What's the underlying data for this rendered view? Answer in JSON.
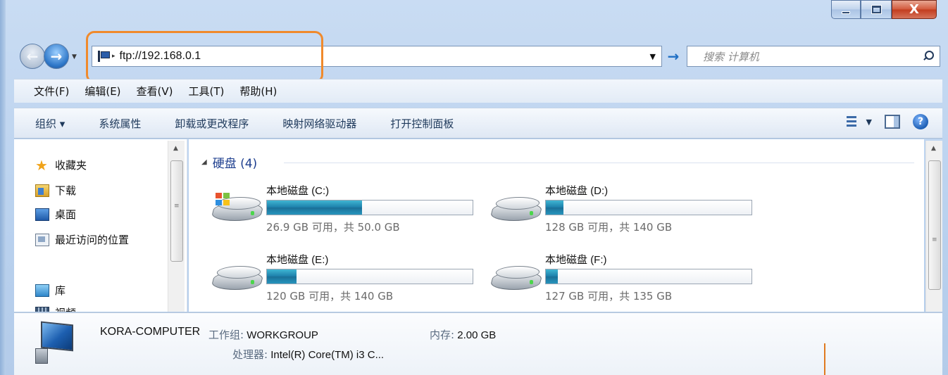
{
  "window": {
    "close_glyph": "X"
  },
  "nav": {
    "address": "ftp://192.168.0.1",
    "search_placeholder": "搜索 计算机"
  },
  "menubar": [
    "文件(F)",
    "编辑(E)",
    "查看(V)",
    "工具(T)",
    "帮助(H)"
  ],
  "commandbar": [
    "组织 ▾",
    "系统属性",
    "卸载或更改程序",
    "映射网络驱动器",
    "打开控制面板"
  ],
  "navpane": {
    "favorites": "收藏夹",
    "downloads": "下载",
    "desktop": "桌面",
    "recent": "最近访问的位置",
    "libraries": "库",
    "videos": "视频"
  },
  "group": {
    "title": "硬盘 (4)"
  },
  "drives": [
    {
      "name_cn": "本地磁盘",
      "letter": "(C:)",
      "free": "26.9 GB 可用，共 50.0 GB",
      "used_fraction": 0.462
    },
    {
      "name_cn": "本地磁盘",
      "letter": "(D:)",
      "free": "128 GB 可用，共 140 GB",
      "used_fraction": 0.086
    },
    {
      "name_cn": "本地磁盘",
      "letter": "(E:)",
      "free": "120 GB 可用，共 140 GB",
      "used_fraction": 0.143
    },
    {
      "name_cn": "本地磁盘",
      "letter": "(F:)",
      "free": "127 GB 可用，共 135 GB",
      "used_fraction": 0.059
    }
  ],
  "details": {
    "computer_name": "KORA-COMPUTER",
    "workgroup_label": "工作组:",
    "workgroup": "WORKGROUP",
    "memory_label": "内存:",
    "memory": "2.00 GB",
    "cpu_label": "处理器:",
    "cpu": "Intel(R) Core(TM) i3 C..."
  },
  "colors": {
    "highlight": "#f08a2c",
    "bar_fill": "#1c7ea9",
    "group_title": "#1e3f8f"
  }
}
